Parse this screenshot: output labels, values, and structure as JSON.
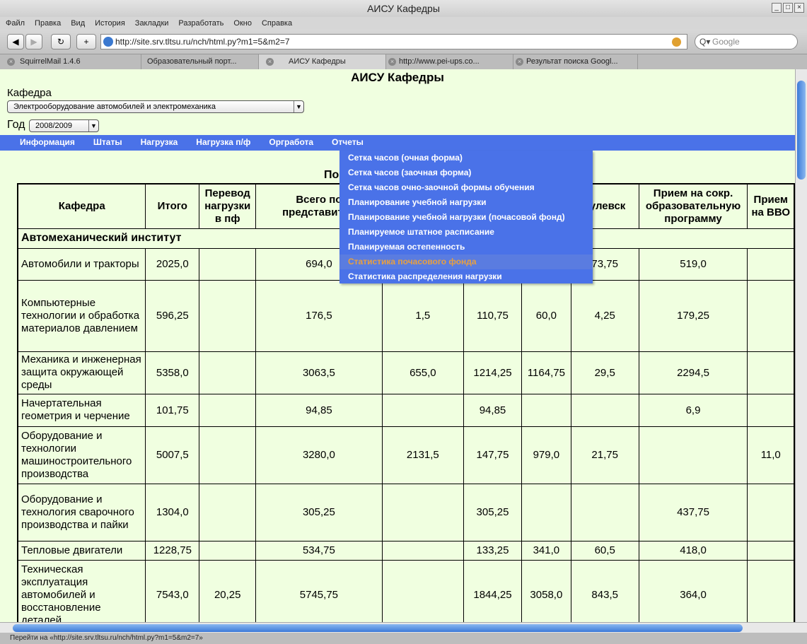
{
  "window": {
    "title": "АИСУ Кафедры"
  },
  "menubar": [
    "Файл",
    "Правка",
    "Вид",
    "История",
    "Закладки",
    "Разработать",
    "Окно",
    "Справка"
  ],
  "toolbar": {
    "url": "http://site.srv.tltsu.ru/nch/html.py?m1=5&m2=7",
    "search_placeholder": "Google"
  },
  "tabs": [
    "SquirrelMail 1.4.6",
    "Образовательный порт...",
    "АИСУ Кафедры",
    "http://www.pei-ups.co...",
    "Результат поиска Googl..."
  ],
  "page": {
    "title": "АИСУ Кафедры",
    "kafedra_label": "Кафедра",
    "kafedra_value": "Электрооборудование автомобилей и электромеханика",
    "year_label": "Год",
    "year_value": "2008/2009",
    "caption": "По"
  },
  "nav": [
    "Информация",
    "Штаты",
    "Нагрузка",
    "Нагрузка п/ф",
    "Оргработа",
    "Отчеты"
  ],
  "reports_menu": {
    "items": [
      "Сетка часов (очная форма)",
      "Сетка часов (заочная форма)",
      "Сетка часов очно-заочной формы обучения",
      "Планирование учебной нагрузки",
      "Планирование учебной нагрузки (почасовой фонд)",
      "Планируемое штатное расписание",
      "Планируемая остепенность",
      "Статистика почасового фонда",
      "Статистика распределения нагрузки"
    ],
    "hovered": "Статистика почасового фонда"
  },
  "table": {
    "headers": [
      "Кафедра",
      "Итого",
      "Перевод нагрузки в пф",
      "Всего по представител",
      "",
      "",
      "",
      "тулевск",
      "Прием на сокр. образовательную программу",
      "Прием на ВВО"
    ],
    "group": "Автомеханический институт",
    "rows": [
      [
        "Автомобили и тракторы",
        "2025,0",
        "",
        "694,0",
        "",
        "",
        "",
        "73,75",
        "519,0",
        ""
      ],
      [
        "Компьютерные технологии и обработка материалов давлением",
        "596,25",
        "",
        "176,5",
        "1,5",
        "110,75",
        "60,0",
        "4,25",
        "179,25",
        ""
      ],
      [
        "Механика и инженерная защита окружающей среды",
        "5358,0",
        "",
        "3063,5",
        "655,0",
        "1214,25",
        "1164,75",
        "29,5",
        "2294,5",
        ""
      ],
      [
        "Начертательная геометрия и черчение",
        "101,75",
        "",
        "94,85",
        "",
        "94,85",
        "",
        "",
        "6,9",
        ""
      ],
      [
        "Оборудование и технологии машиностроительного производства",
        "5007,5",
        "",
        "3280,0",
        "2131,5",
        "147,75",
        "979,0",
        "21,75",
        "",
        "11,0"
      ],
      [
        "Оборудование и технология сварочного производства и пайки",
        "1304,0",
        "",
        "305,25",
        "",
        "305,25",
        "",
        "",
        "437,75",
        ""
      ],
      [
        "Тепловые двигатели",
        "1228,75",
        "",
        "534,75",
        "",
        "133,25",
        "341,0",
        "60,5",
        "418,0",
        ""
      ],
      [
        "Техническая эксплуатация автомобилей и восстановление деталей",
        "7543,0",
        "20,25",
        "5745,75",
        "",
        "1844,25",
        "3058,0",
        "843,5",
        "364,0",
        ""
      ]
    ]
  },
  "status": "Перейти на «http://site.srv.tltsu.ru/nch/html.py?m1=5&m2=7»"
}
